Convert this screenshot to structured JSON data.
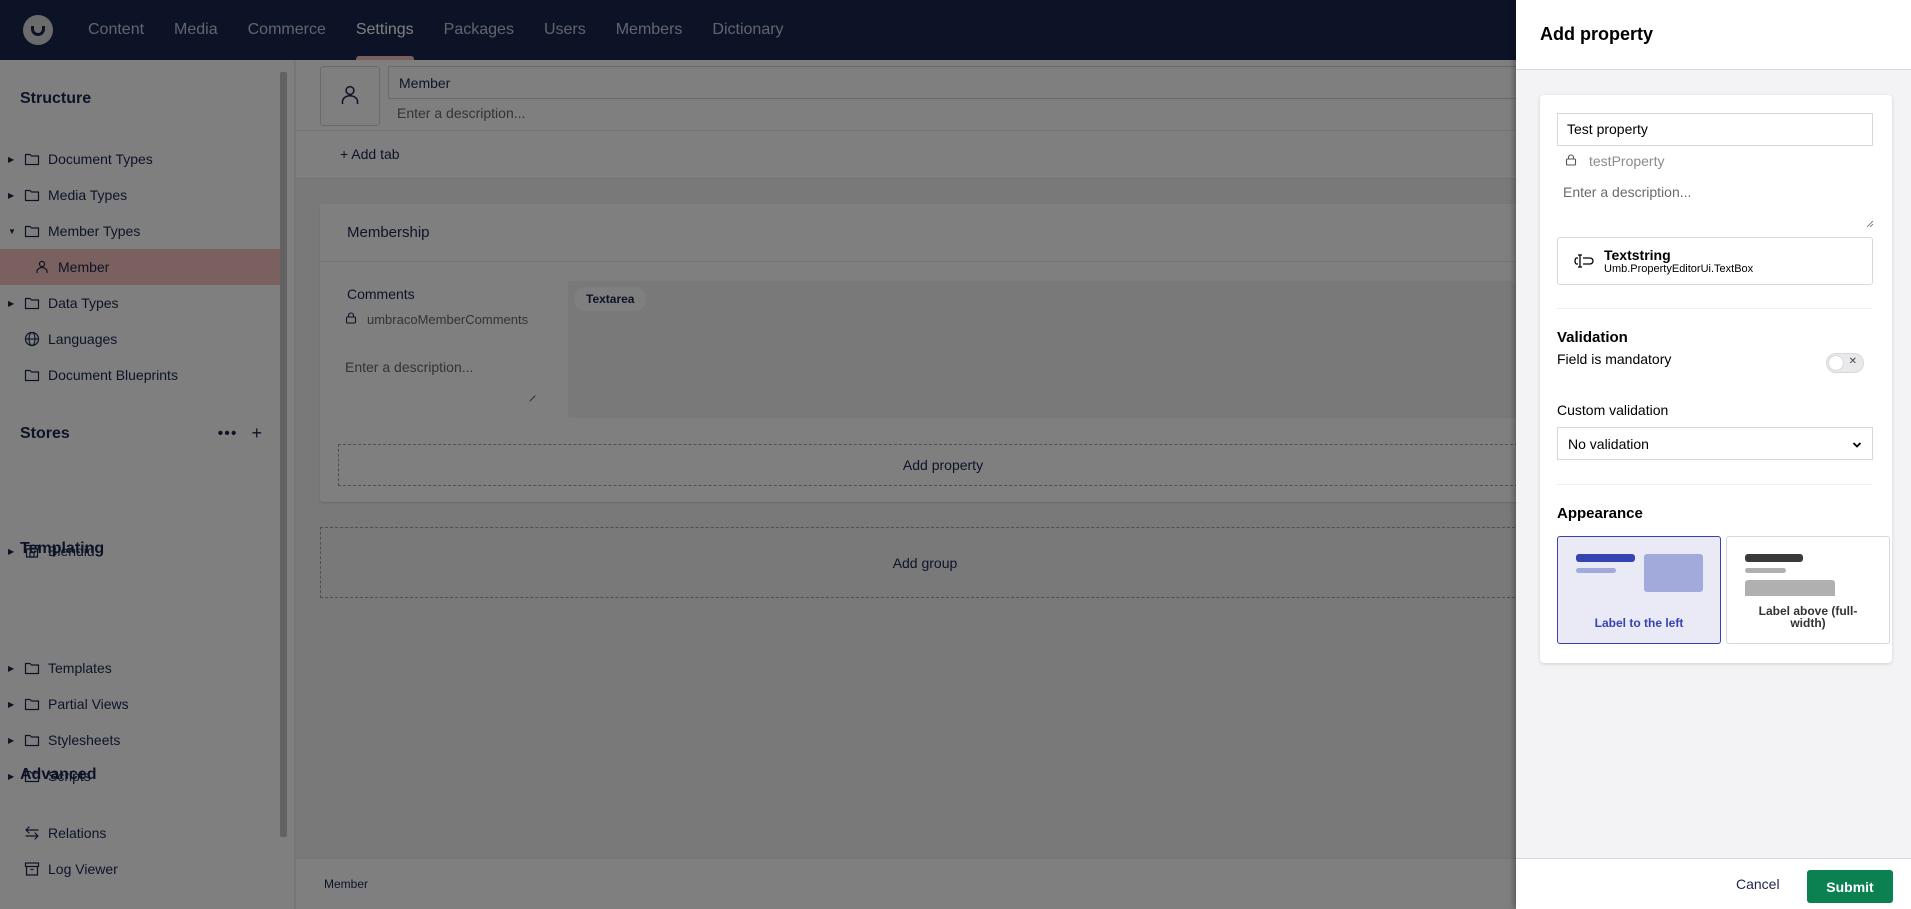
{
  "topbar": {
    "nav": [
      {
        "label": "Content",
        "active": false
      },
      {
        "label": "Media",
        "active": false
      },
      {
        "label": "Commerce",
        "active": false
      },
      {
        "label": "Settings",
        "active": true
      },
      {
        "label": "Packages",
        "active": false
      },
      {
        "label": "Users",
        "active": false
      },
      {
        "label": "Members",
        "active": false
      },
      {
        "label": "Dictionary",
        "active": false
      }
    ]
  },
  "sidebar": {
    "structure_heading": "Structure",
    "structure_items": [
      {
        "label": "Document Types",
        "icon": "folder-icon",
        "caret": "right"
      },
      {
        "label": "Media Types",
        "icon": "folder-icon",
        "caret": "right"
      },
      {
        "label": "Member Types",
        "icon": "folder-icon",
        "caret": "down"
      },
      {
        "label": "Member",
        "icon": "user-icon",
        "caret": "",
        "active": true,
        "child": true
      },
      {
        "label": "Data Types",
        "icon": "folder-icon",
        "caret": "right"
      },
      {
        "label": "Languages",
        "icon": "globe-icon",
        "caret": ""
      },
      {
        "label": "Document Blueprints",
        "icon": "folder-icon",
        "caret": ""
      }
    ],
    "stores_heading": "Stores",
    "stores_items": [
      {
        "label": "Blendid",
        "icon": "store-icon",
        "caret": "right"
      }
    ],
    "templating_heading": "Templating",
    "templating_items": [
      {
        "label": "Templates",
        "icon": "folder-icon",
        "caret": "right"
      },
      {
        "label": "Partial Views",
        "icon": "folder-icon",
        "caret": "right"
      },
      {
        "label": "Stylesheets",
        "icon": "folder-icon",
        "caret": "right"
      },
      {
        "label": "Scripts",
        "icon": "folder-icon",
        "caret": "right"
      }
    ],
    "advanced_heading": "Advanced",
    "advanced_items": [
      {
        "label": "Relations",
        "icon": "arrows-exchange-icon"
      },
      {
        "label": "Log Viewer",
        "icon": "archive-icon"
      }
    ]
  },
  "main": {
    "doc_name": "Member",
    "doc_description_placeholder": "Enter a description...",
    "add_tab_label": "Add tab",
    "group_title": "Membership",
    "property": {
      "label": "Comments",
      "alias": "umbracoMemberComments",
      "description_placeholder": "Enter a description...",
      "editor_badge": "Textarea"
    },
    "add_property_label": "Add property",
    "add_group_label": "Add group",
    "footer_breadcrumb": "Member"
  },
  "panel": {
    "title": "Add property",
    "name_value": "Test property",
    "alias_value": "testProperty",
    "description_placeholder": "Enter a description...",
    "editor": {
      "name": "Textstring",
      "alias": "Umb.PropertyEditorUi.TextBox"
    },
    "validation_heading": "Validation",
    "mandatory_label": "Field is mandatory",
    "mandatory_on": false,
    "custom_validation_label": "Custom validation",
    "custom_validation_value": "No validation",
    "appearance_heading": "Appearance",
    "appearance_options": [
      {
        "label": "Label to the left",
        "selected": true
      },
      {
        "label": "Label above (full-width)",
        "selected": false
      }
    ],
    "cancel_label": "Cancel",
    "submit_label": "Submit"
  },
  "colors": {
    "topbar": "#1b264f",
    "nav_active_indicator": "#f5c1bc",
    "selected_tree_item": "#f5c1bc",
    "appearance_selected": "#3544b1",
    "submit": "#0b8152"
  }
}
